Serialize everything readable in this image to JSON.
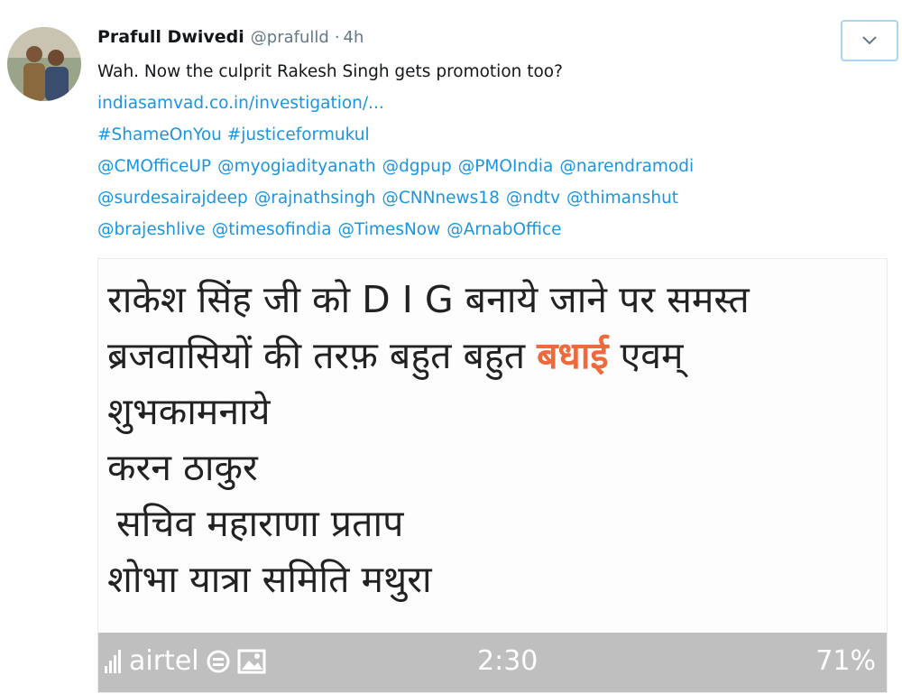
{
  "tweet": {
    "author_name": "Prafull Dwivedi",
    "handle": "@prafulld",
    "separator": "·",
    "time": "4h",
    "text": "Wah. Now the culprit Rakesh Singh gets promotion too?",
    "link": "indiasamvad.co.in/investigation/...",
    "hashtags": "#ShameOnYou #justiceformukul",
    "mention_lines": [
      [
        "@CMOfficeUP",
        "@myogiadityanath",
        "@dgpup",
        "@PMOIndia",
        "@narendramodi"
      ],
      [
        "@surdesairajdeep",
        "@rajnathsingh",
        "@CNNnews18",
        "@ndtv",
        "@thimanshut"
      ],
      [
        "@brajeshlive",
        "@timesofindia",
        "@TimesNow",
        "@ArnabOffice"
      ]
    ]
  },
  "media": {
    "lines": {
      "l1": "राकेश सिंह जी को D I G बनाये जाने पर समस्त",
      "l2a": "ब्रजवासियों की तरफ़ बहुत बहुत ",
      "l2b": "बधाई",
      "l2c": " एवम्",
      "l3": "शुभकामनाये",
      "l4": "करन ठाकुर",
      "l5": "सचिव महाराणा प्रताप",
      "l6": "शोभा यात्रा समिति मथुरा"
    },
    "highlight_color": "#ed6a3c",
    "status_bar": {
      "carrier": "airtel",
      "clock": "2:30",
      "battery": "71%",
      "icons": [
        "signal-icon",
        "sync-icon",
        "image-icon"
      ]
    }
  },
  "colors": {
    "link": "#1b95e0",
    "text": "#14171a",
    "meta": "#657786",
    "status_bar_bg": "#bfbfbf"
  }
}
